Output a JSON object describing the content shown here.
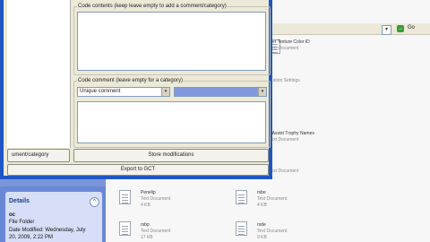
{
  "explorer": {
    "go_label": "Go",
    "go_glyph": "→",
    "addr_dropdown_glyph": "▾",
    "files_right": [
      {
        "name": "ster Texture Color ID",
        "type": "Text Document"
      },
      {
        "name": "gr",
        "type": "aration Settings"
      },
      {
        "name": "y Assist Trophy Names",
        "type": "Text Document"
      },
      {
        "name": "el",
        "type": "Text Document"
      }
    ],
    "files_bottom": [
      {
        "name": "Penelip",
        "type": "Text Document",
        "size": "4 KB"
      },
      {
        "name": "rsbe",
        "type": "Text Document",
        "size": "4 KB"
      },
      {
        "name": "rsbp",
        "type": "Text Document",
        "size": "17 KB"
      },
      {
        "name": "rsde",
        "type": "Text Document",
        "size": "9 KB"
      }
    ],
    "details": {
      "title": "Details",
      "toggle_glyph": "^",
      "name": "oc",
      "kind": "File Folder",
      "modified": "Date Modified: Wednesday, July",
      "modified2": "20, 2009, 2:22 PM"
    }
  },
  "dialog": {
    "code_contents_label": "Code contents (keep leave empty to add a comment/category)",
    "code_comment_label": "Code comment (leave empty for a category)",
    "comment_type_value": "Unique comment",
    "dropdown_glyph": "▾",
    "left_button_label": "ument/category",
    "store_button_label": "Store modifications",
    "export_button_label": "Export to GCT"
  }
}
